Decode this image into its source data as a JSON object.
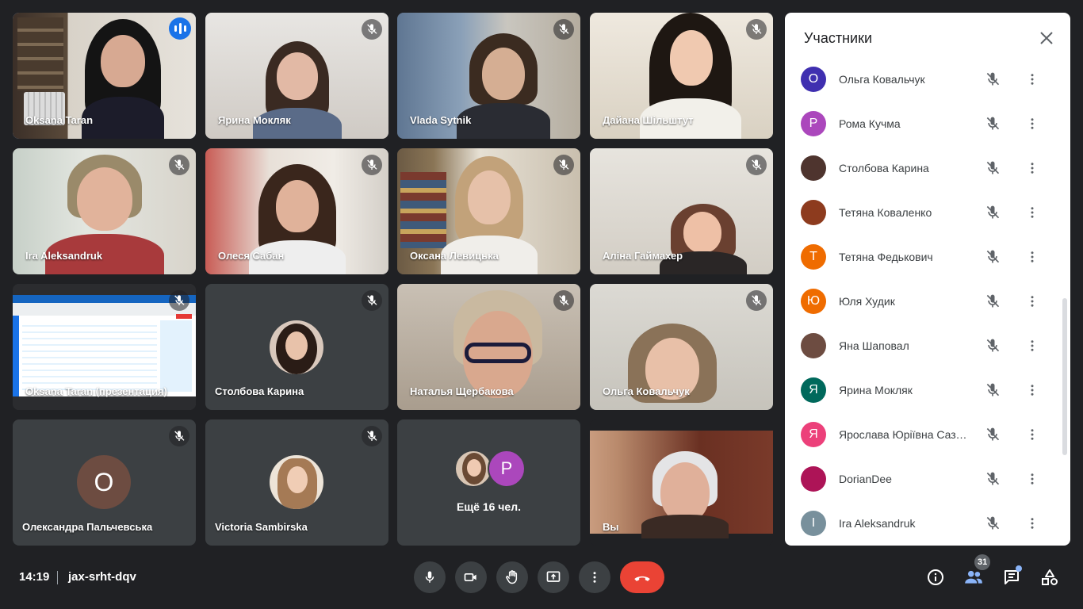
{
  "grid": {
    "tiles": [
      {
        "name": "Oksana Taran",
        "speaking": true
      },
      {
        "name": "Ярина Мокляк",
        "muted": true
      },
      {
        "name": "Vlada Sytnik",
        "muted": true
      },
      {
        "name": "Дайана Шільштут",
        "muted": true
      },
      {
        "name": "Ira Aleksandruk",
        "muted": true
      },
      {
        "name": "Олеся Сабан",
        "muted": true
      },
      {
        "name": "Оксана Левицька",
        "muted": true
      },
      {
        "name": "Аліна Гаймахер",
        "muted": true
      },
      {
        "name": "Oksana Taran (презентация)",
        "muted": true
      },
      {
        "name": "Столбова Карина",
        "muted": true
      },
      {
        "name": "Наталья Щербакова",
        "muted": true
      },
      {
        "name": "Ольга Ковальчук",
        "muted": true
      },
      {
        "name": "Олександра Пальчевська",
        "muted": true,
        "initial": "O",
        "color": "#6d4c41"
      },
      {
        "name": "Victoria Sambirska",
        "muted": true
      },
      {
        "more_label": "Ещё 16 чел.",
        "initial": "P",
        "color": "#ab47bc"
      },
      {
        "name": "Вы"
      }
    ]
  },
  "panel": {
    "title": "Участники",
    "participants": [
      {
        "name": "Ольга Ковальчук",
        "initial": "O",
        "color": "#3f2fb0"
      },
      {
        "name": "Рома Кучма",
        "initial": "P",
        "color": "#ab47bc"
      },
      {
        "name": "Столбова Карина",
        "initial": "",
        "color": "#4e342e"
      },
      {
        "name": "Тетяна Коваленко",
        "initial": "",
        "color": "#8d3b1e"
      },
      {
        "name": "Тетяна Федькович",
        "initial": "T",
        "color": "#ef6c00"
      },
      {
        "name": "Юля Худик",
        "initial": "Ю",
        "color": "#ef6c00"
      },
      {
        "name": "Яна Шаповал",
        "initial": "",
        "color": "#6d4c41"
      },
      {
        "name": "Ярина Мокляк",
        "initial": "Я",
        "color": "#00695c"
      },
      {
        "name": "Ярослава Юріївна Сазо...",
        "initial": "Я",
        "color": "#ec407a"
      },
      {
        "name": "DorianDee",
        "initial": "",
        "color": "#ad1457"
      },
      {
        "name": "Ira Aleksandruk",
        "initial": "I",
        "color": "#78909c"
      }
    ]
  },
  "bottom": {
    "time": "14:19",
    "meeting_code": "jax-srht-dqv",
    "participants_count": "31"
  }
}
